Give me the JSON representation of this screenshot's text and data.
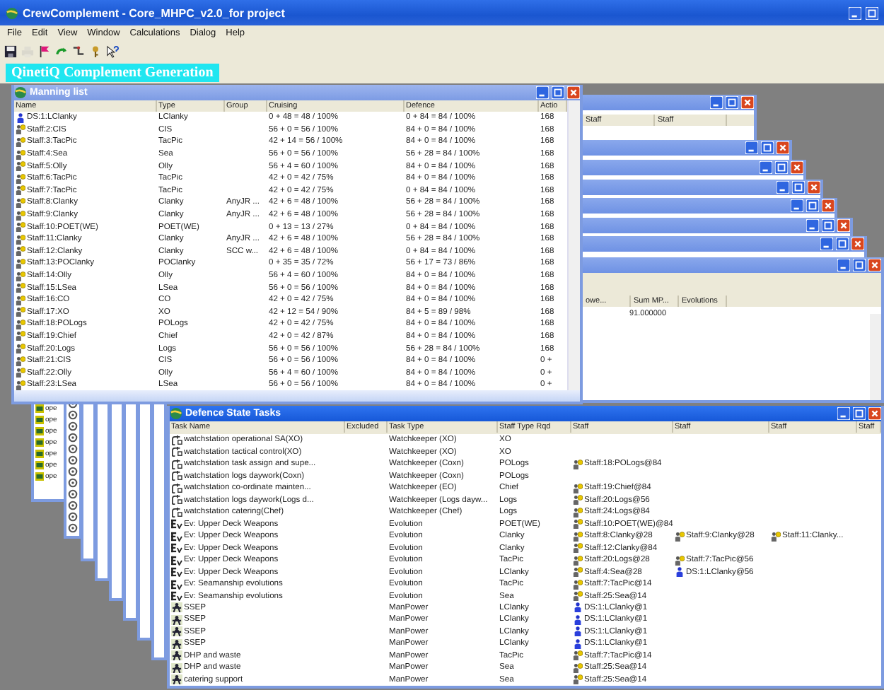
{
  "window": {
    "title": "CrewComplement - Core_MHPC_v2.0_for project"
  },
  "menu": [
    "File",
    "Edit",
    "View",
    "Window",
    "Calculations",
    "Dialog",
    "Help"
  ],
  "toolbar": [
    {
      "kind": "save",
      "disabled": false
    },
    {
      "kind": "print",
      "disabled": true
    },
    {
      "kind": "flag",
      "disabled": false
    },
    {
      "kind": "arrow",
      "disabled": false
    },
    {
      "kind": "pipe",
      "disabled": false
    },
    {
      "kind": "key",
      "disabled": false
    },
    {
      "kind": "help",
      "disabled": false
    }
  ],
  "banner": "QinetiQ Complement Generation",
  "stacked_windows": [
    {
      "kind": "table",
      "columns": [
        "Staff",
        "Staff"
      ]
    },
    {
      "kind": "bar"
    },
    {
      "kind": "bar"
    },
    {
      "kind": "bar"
    },
    {
      "kind": "bar"
    },
    {
      "kind": "bar"
    },
    {
      "kind": "bar"
    },
    {
      "kind": "table",
      "columns": [
        "owe...",
        "Sum MP...",
        "Evolutions"
      ],
      "rows": [
        {
          "sum_mp": "91.000000"
        }
      ]
    }
  ],
  "side_windows": [
    {
      "kind": "list",
      "items": [
        "ope",
        "ope",
        "ope",
        "ope",
        "ope",
        "ope",
        "ope"
      ]
    },
    {
      "kind": "icons"
    },
    {
      "kind": "strip"
    },
    {
      "kind": "strip"
    },
    {
      "kind": "strip"
    },
    {
      "kind": "strip"
    },
    {
      "kind": "strip"
    },
    {
      "kind": "strip"
    }
  ],
  "manning_list": {
    "title": "Manning list",
    "columns": [
      "Name",
      "Type",
      "Group",
      "Cruising",
      "Defence",
      "Actio"
    ],
    "rows": [
      {
        "kind": "ds",
        "name": "DS:1:LClanky",
        "type": "LClanky",
        "cruising": "0 + 48 = 48 / 100%",
        "defence": "0 + 84 = 84 / 100%",
        "action": "168"
      },
      {
        "kind": "staff",
        "name": "Staff:2:CIS",
        "type": "CIS",
        "cruising": "56 + 0 = 56 / 100%",
        "defence": "84 + 0 = 84 / 100%",
        "action": "168"
      },
      {
        "kind": "staff",
        "name": "Staff:3:TacPic",
        "type": "TacPic",
        "cruising": "42 + 14 = 56 / 100%",
        "defence": "84 + 0 = 84 / 100%",
        "action": "168"
      },
      {
        "kind": "staff",
        "name": "Staff:4:Sea",
        "type": "Sea",
        "cruising": "56 + 0 = 56 / 100%",
        "defence": "56 + 28 = 84 / 100%",
        "action": "168"
      },
      {
        "kind": "staff",
        "name": "Staff:5:Olly",
        "type": "Olly",
        "cruising": "56 + 4 = 60 / 100%",
        "defence": "84 + 0 = 84 / 100%",
        "action": "168"
      },
      {
        "kind": "staff",
        "name": "Staff:6:TacPic",
        "type": "TacPic",
        "cruising": "42 + 0 = 42 / 75%",
        "defence": "84 + 0 = 84 / 100%",
        "action": "168"
      },
      {
        "kind": "staff",
        "name": "Staff:7:TacPic",
        "type": "TacPic",
        "cruising": "42 + 0 = 42 / 75%",
        "defence": "0 + 84 = 84 / 100%",
        "action": "168"
      },
      {
        "kind": "staff",
        "name": "Staff:8:Clanky",
        "type": "Clanky",
        "group": "AnyJR ...",
        "cruising": "42 + 6 = 48 / 100%",
        "defence": "56 + 28 = 84 / 100%",
        "action": "168"
      },
      {
        "kind": "staff",
        "name": "Staff:9:Clanky",
        "type": "Clanky",
        "group": "AnyJR ...",
        "cruising": "42 + 6 = 48 / 100%",
        "defence": "56 + 28 = 84 / 100%",
        "action": "168"
      },
      {
        "kind": "staff",
        "name": "Staff:10:POET(WE)",
        "type": "POET(WE)",
        "cruising": "0 + 13 = 13 / 27%",
        "defence": "0 + 84 = 84 / 100%",
        "action": "168"
      },
      {
        "kind": "staff",
        "name": "Staff:11:Clanky",
        "type": "Clanky",
        "group": "AnyJR ...",
        "cruising": "42 + 6 = 48 / 100%",
        "defence": "56 + 28 = 84 / 100%",
        "action": "168"
      },
      {
        "kind": "staff",
        "name": "Staff:12:Clanky",
        "type": "Clanky",
        "group": "SCC w...",
        "cruising": "42 + 6 = 48 / 100%",
        "defence": "0 + 84 = 84 / 100%",
        "action": "168"
      },
      {
        "kind": "staff",
        "name": "Staff:13:POClanky",
        "type": "POClanky",
        "cruising": "0 + 35 = 35 / 72%",
        "defence": "56 + 17 = 73 / 86%",
        "action": "168"
      },
      {
        "kind": "staff",
        "name": "Staff:14:Olly",
        "type": "Olly",
        "cruising": "56 + 4 = 60 / 100%",
        "defence": "84 + 0 = 84 / 100%",
        "action": "168"
      },
      {
        "kind": "staff",
        "name": "Staff:15:LSea",
        "type": "LSea",
        "cruising": "56 + 0 = 56 / 100%",
        "defence": "84 + 0 = 84 / 100%",
        "action": "168"
      },
      {
        "kind": "staff",
        "name": "Staff:16:CO",
        "type": "CO",
        "cruising": "42 + 0 = 42 / 75%",
        "defence": "84 + 0 = 84 / 100%",
        "action": "168"
      },
      {
        "kind": "staff",
        "name": "Staff:17:XO",
        "type": "XO",
        "cruising": "42 + 12 = 54 / 90%",
        "defence": "84 + 5 = 89 / 98%",
        "action": "168"
      },
      {
        "kind": "staff",
        "name": "Staff:18:POLogs",
        "type": "POLogs",
        "cruising": "42 + 0 = 42 / 75%",
        "defence": "84 + 0 = 84 / 100%",
        "action": "168"
      },
      {
        "kind": "staff",
        "name": "Staff:19:Chief",
        "type": "Chief",
        "cruising": "42 + 0 = 42 / 87%",
        "defence": "84 + 0 = 84 / 100%",
        "action": "168"
      },
      {
        "kind": "staff",
        "name": "Staff:20:Logs",
        "type": "Logs",
        "cruising": "56 + 0 = 56 / 100%",
        "defence": "56 + 28 = 84 / 100%",
        "action": "168"
      },
      {
        "kind": "staff",
        "name": "Staff:21:CIS",
        "type": "CIS",
        "cruising": "56 + 0 = 56 / 100%",
        "defence": "84 + 0 = 84 / 100%",
        "action": "0 +"
      },
      {
        "kind": "staff",
        "name": "Staff:22:Olly",
        "type": "Olly",
        "cruising": "56 + 4 = 60 / 100%",
        "defence": "84 + 0 = 84 / 100%",
        "action": "0 +"
      },
      {
        "kind": "staff",
        "name": "Staff:23:LSea",
        "type": "LSea",
        "cruising": "56 + 0 = 56 / 100%",
        "defence": "84 + 0 = 84 / 100%",
        "action": "0 +"
      }
    ]
  },
  "defence_tasks": {
    "title": "Defence State Tasks",
    "columns": [
      "Task Name",
      "Excluded",
      "Task Type",
      "Staff Type Rqd",
      "Staff",
      "Staff",
      "Staff",
      "Staff"
    ],
    "rows": [
      {
        "kind": "watch",
        "name": "watchstation operational SA(XO)",
        "type": "Watchkeeper (XO)",
        "staff_type": "XO",
        "staff": []
      },
      {
        "kind": "watch",
        "name": "watchstation tactical control(XO)",
        "type": "Watchkeeper (XO)",
        "staff_type": "XO",
        "staff": []
      },
      {
        "kind": "watch",
        "name": "watchstation task assign and supe...",
        "type": "Watchkeeper (Coxn)",
        "staff_type": "POLogs",
        "staff": [
          {
            "kind": "staff",
            "name": "Staff:18:POLogs@84"
          }
        ]
      },
      {
        "kind": "watch",
        "name": "watchstation logs daywork(Coxn)",
        "type": "Watchkeeper (Coxn)",
        "staff_type": "POLogs",
        "staff": []
      },
      {
        "kind": "watch",
        "name": "watchstation co-ordinate mainten...",
        "type": "Watchkeeper (EO)",
        "staff_type": "Chief",
        "staff": [
          {
            "kind": "staff",
            "name": "Staff:19:Chief@84"
          }
        ]
      },
      {
        "kind": "watch",
        "name": "watchstation logs daywork(Logs d...",
        "type": "Watchkeeper (Logs dayw...",
        "staff_type": "Logs",
        "staff": [
          {
            "kind": "staff",
            "name": "Staff:20:Logs@56"
          }
        ]
      },
      {
        "kind": "watch",
        "name": "watchstation catering(Chef)",
        "type": "Watchkeeper (Chef)",
        "staff_type": "Logs",
        "staff": [
          {
            "kind": "staff",
            "name": "Staff:24:Logs@84"
          }
        ]
      },
      {
        "kind": "evolution",
        "name": "Ev: Upper Deck Weapons",
        "type": "Evolution",
        "staff_type": "POET(WE)",
        "staff": [
          {
            "kind": "staff",
            "name": "Staff:10:POET(WE)@84"
          }
        ]
      },
      {
        "kind": "evolution",
        "name": "Ev: Upper Deck Weapons",
        "type": "Evolution",
        "staff_type": "Clanky",
        "staff": [
          {
            "kind": "staff",
            "name": "Staff:8:Clanky@28"
          },
          {
            "kind": "staff",
            "name": "Staff:9:Clanky@28"
          },
          {
            "kind": "staff",
            "name": "Staff:11:Clanky..."
          }
        ]
      },
      {
        "kind": "evolution",
        "name": "Ev: Upper Deck Weapons",
        "type": "Evolution",
        "staff_type": "Clanky",
        "staff": [
          {
            "kind": "staff",
            "name": "Staff:12:Clanky@84"
          }
        ]
      },
      {
        "kind": "evolution",
        "name": "Ev: Upper Deck Weapons",
        "type": "Evolution",
        "staff_type": "TacPic",
        "staff": [
          {
            "kind": "staff",
            "name": "Staff:20:Logs@28"
          },
          {
            "kind": "staff",
            "name": "Staff:7:TacPic@56"
          }
        ]
      },
      {
        "kind": "evolution",
        "name": "Ev: Upper Deck Weapons",
        "type": "Evolution",
        "staff_type": "LClanky",
        "staff": [
          {
            "kind": "staff",
            "name": "Staff:4:Sea@28"
          },
          {
            "kind": "ds",
            "name": "DS:1:LClanky@56"
          }
        ]
      },
      {
        "kind": "evolution",
        "name": "Ev: Seamanship evolutions",
        "type": "Evolution",
        "staff_type": "TacPic",
        "staff": [
          {
            "kind": "staff",
            "name": "Staff:7:TacPic@14"
          }
        ]
      },
      {
        "kind": "evolution",
        "name": "Ev: Seamanship evolutions",
        "type": "Evolution",
        "staff_type": "Sea",
        "staff": [
          {
            "kind": "staff",
            "name": "Staff:25:Sea@14"
          }
        ]
      },
      {
        "kind": "manpower",
        "name": "SSEP",
        "type": "ManPower",
        "staff_type": "LClanky",
        "staff": [
          {
            "kind": "ds",
            "name": "DS:1:LClanky@1"
          }
        ]
      },
      {
        "kind": "manpower",
        "name": "SSEP",
        "type": "ManPower",
        "staff_type": "LClanky",
        "staff": [
          {
            "kind": "ds",
            "name": "DS:1:LClanky@1"
          }
        ]
      },
      {
        "kind": "manpower",
        "name": "SSEP",
        "type": "ManPower",
        "staff_type": "LClanky",
        "staff": [
          {
            "kind": "ds",
            "name": "DS:1:LClanky@1"
          }
        ]
      },
      {
        "kind": "manpower",
        "name": "SSEP",
        "type": "ManPower",
        "staff_type": "LClanky",
        "staff": [
          {
            "kind": "ds",
            "name": "DS:1:LClanky@1"
          }
        ]
      },
      {
        "kind": "manpower",
        "name": "DHP and waste",
        "type": "ManPower",
        "staff_type": "TacPic",
        "staff": [
          {
            "kind": "staff",
            "name": "Staff:7:TacPic@14"
          }
        ]
      },
      {
        "kind": "manpower",
        "name": "DHP and waste",
        "type": "ManPower",
        "staff_type": "Sea",
        "staff": [
          {
            "kind": "staff",
            "name": "Staff:25:Sea@14"
          }
        ]
      },
      {
        "kind": "manpower",
        "name": "catering support",
        "type": "ManPower",
        "staff_type": "Sea",
        "staff": [
          {
            "kind": "staff",
            "name": "Staff:25:Sea@14"
          }
        ]
      }
    ]
  }
}
